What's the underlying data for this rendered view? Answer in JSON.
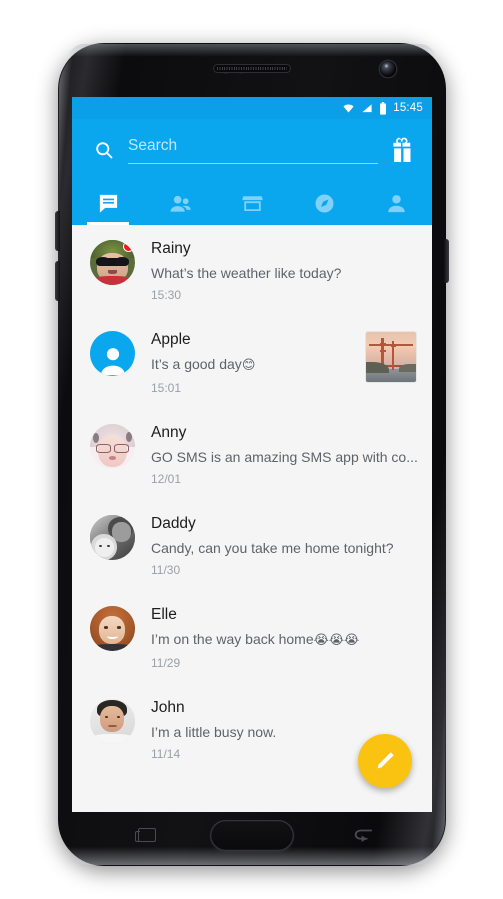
{
  "device": {
    "name": "samsung-galaxy-s7-edge-mockup",
    "hardware": {
      "earpiece": "speaker-grille",
      "front_camera": "front-camera",
      "sensors": "proximity-sensor",
      "home_button": "home-button",
      "recents_button": "recents-button",
      "back_button": "back-button",
      "volume_up": "volume-up-button",
      "volume_down": "volume-down-button",
      "power": "power-button"
    }
  },
  "statusbar": {
    "time": "15:45",
    "icons": [
      "wifi-icon",
      "signal-icon",
      "battery-icon"
    ],
    "background": "#0b9fe8"
  },
  "appbar": {
    "background": "#0aa7ef",
    "search": {
      "icon": "search-icon",
      "placeholder": "Search",
      "value": ""
    },
    "gift_button": {
      "icon": "gift-icon",
      "label": "Gift"
    }
  },
  "tabs": [
    {
      "name": "messages",
      "icon": "chat-bubble-icon",
      "active": true
    },
    {
      "name": "contacts",
      "icon": "people-icon",
      "active": false
    },
    {
      "name": "store",
      "icon": "store-icon",
      "active": false
    },
    {
      "name": "discover",
      "icon": "compass-icon",
      "active": false
    },
    {
      "name": "profile",
      "icon": "person-icon",
      "active": false
    }
  ],
  "list": {
    "background": "#f5f5f5",
    "conversations": [
      {
        "name": "Rainy",
        "preview": "What’s the weather like today?",
        "time": "15:30",
        "unread_badge": true,
        "avatar": "photo-sunglasses-wreath",
        "attachment": null
      },
      {
        "name": "Apple",
        "preview": "It’s a good day",
        "preview_emoji": "😊",
        "time": "15:01",
        "unread_badge": false,
        "avatar": "default-person-blue",
        "attachment": "golden-gate-bridge-thumbnail"
      },
      {
        "name": "Anny",
        "preview": "GO SMS is an amazing SMS app with co...",
        "time": "12/01",
        "unread_badge": false,
        "avatar": "photo-woman-glasses",
        "attachment": null
      },
      {
        "name": "Daddy",
        "preview": "Candy, can you take me home tonight?",
        "time": "11/30",
        "unread_badge": false,
        "avatar": "photo-father-baby-bw",
        "attachment": null
      },
      {
        "name": "Elle",
        "preview": "I’m on the way back home",
        "preview_emoji": "😭😭😭",
        "time": "11/29",
        "unread_badge": false,
        "avatar": "photo-woman-redhair",
        "attachment": null
      },
      {
        "name": "John",
        "preview": "I’m a little busy now.",
        "time": "11/14",
        "unread_badge": false,
        "avatar": "photo-man-dark-hair",
        "attachment": null
      }
    ]
  },
  "fab": {
    "icon": "compose-pencil-icon",
    "label": "New message",
    "color": "#fbc311"
  },
  "colors": {
    "accent": "#0aa7ef",
    "statusbar": "#0b9fe8",
    "fab": "#fbc311",
    "badge": "#f5151f",
    "list_bg": "#f5f5f5",
    "name_text": "#1d1d1d",
    "preview_text": "#5f6368",
    "time_text": "#9aa0a6"
  }
}
